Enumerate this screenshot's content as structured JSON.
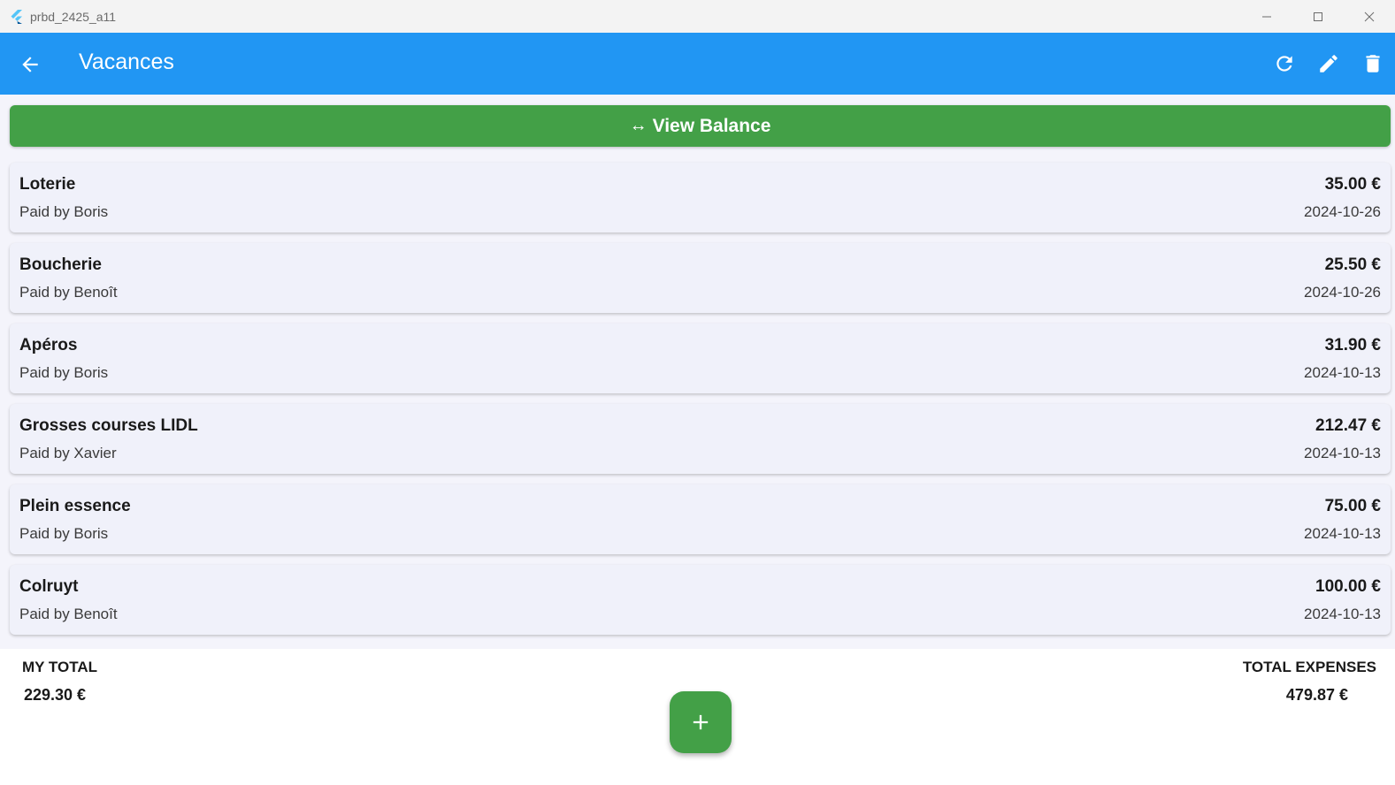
{
  "window": {
    "title": "prbd_2425_a11"
  },
  "appbar": {
    "title": "Vacances",
    "color": "#2196f3",
    "actions": [
      "refresh-icon",
      "edit-icon",
      "delete-icon"
    ]
  },
  "balance_button": {
    "arrow": "↔",
    "label": "View Balance",
    "color": "#43a047"
  },
  "expenses": [
    {
      "name": "Loterie",
      "payer": "Paid by Boris",
      "amount": "35.00 €",
      "date": "2024-10-26"
    },
    {
      "name": "Boucherie",
      "payer": "Paid by Benoît",
      "amount": "25.50 €",
      "date": "2024-10-26"
    },
    {
      "name": "Apéros",
      "payer": "Paid by Boris",
      "amount": "31.90 €",
      "date": "2024-10-13"
    },
    {
      "name": "Grosses courses LIDL",
      "payer": "Paid by Xavier",
      "amount": "212.47 €",
      "date": "2024-10-13"
    },
    {
      "name": "Plein essence",
      "payer": "Paid by Boris",
      "amount": "75.00 €",
      "date": "2024-10-13"
    },
    {
      "name": "Colruyt",
      "payer": "Paid by Benoît",
      "amount": "100.00 €",
      "date": "2024-10-13"
    }
  ],
  "footer": {
    "my_total_label": "MY TOTAL",
    "my_total_value": "229.30 €",
    "total_expenses_label": "TOTAL EXPENSES",
    "total_expenses_value": "479.87 €"
  },
  "fab": {
    "icon": "plus-icon",
    "color": "#43a047"
  }
}
